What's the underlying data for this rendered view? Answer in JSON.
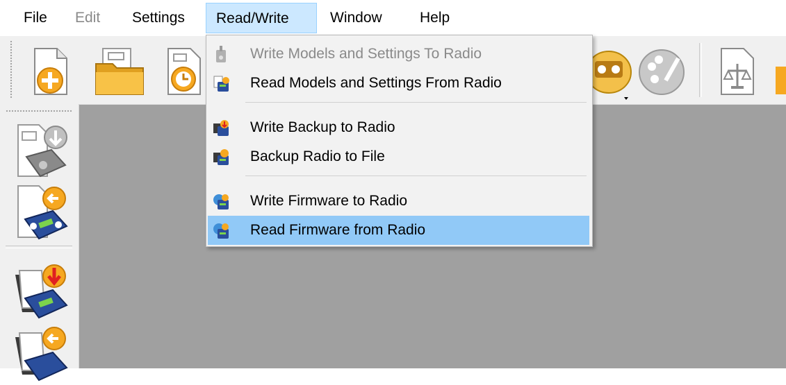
{
  "menubar": {
    "items": [
      {
        "label": "File",
        "enabled": true
      },
      {
        "label": "Edit",
        "enabled": false
      },
      {
        "label": "Settings",
        "enabled": true
      },
      {
        "label": "Read/Write",
        "enabled": true,
        "active": true
      },
      {
        "label": "Window",
        "enabled": true
      },
      {
        "label": "Help",
        "enabled": true
      }
    ]
  },
  "dropdown": {
    "items": [
      {
        "label": "Write Models and Settings To Radio",
        "enabled": false,
        "icon": "radio-write-icon"
      },
      {
        "label": "Read Models and Settings From Radio",
        "enabled": true,
        "icon": "radio-read-icon"
      },
      {
        "label": "Write Backup to Radio",
        "enabled": true,
        "icon": "backup-write-icon"
      },
      {
        "label": "Backup Radio to File",
        "enabled": true,
        "icon": "backup-file-icon"
      },
      {
        "label": "Write Firmware to Radio",
        "enabled": true,
        "icon": "firmware-write-icon"
      },
      {
        "label": "Read Firmware from Radio",
        "enabled": true,
        "highlighted": true,
        "icon": "firmware-read-icon"
      }
    ]
  },
  "toolbar": {
    "icons": [
      "new-file-icon",
      "open-folder-icon",
      "recent-files-icon",
      "radio-settings-icon",
      "palette-icon",
      "compare-icon",
      "more-icon"
    ]
  },
  "left_toolbar": {
    "icons": [
      "write-to-radio-icon",
      "read-from-radio-icon",
      "write-to-radio-file-icon",
      "read-from-radio-file-icon"
    ]
  },
  "colors": {
    "menu_active_bg": "#cce8ff",
    "menu_highlight_bg": "#91c9f7",
    "workspace_bg": "#a0a0a0",
    "toolbar_bg": "#f0f0f0"
  }
}
